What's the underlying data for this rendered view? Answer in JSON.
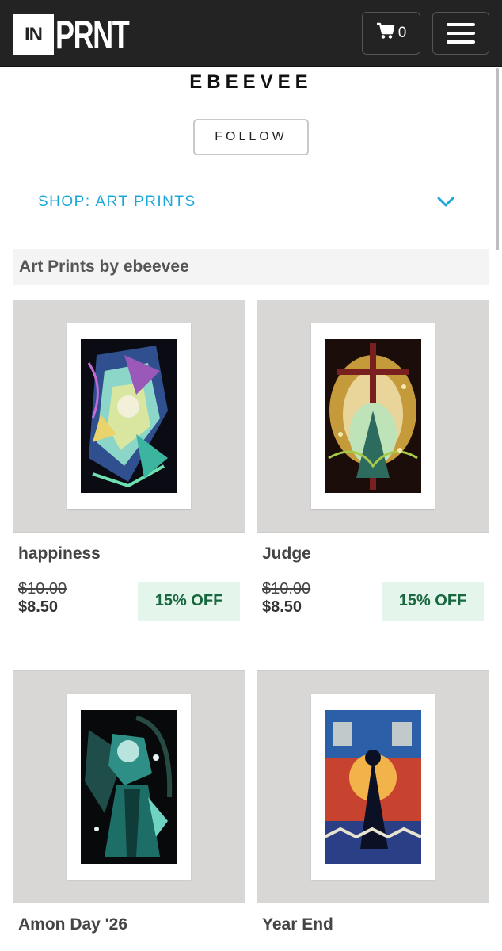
{
  "header": {
    "logo_box": "IN",
    "logo_text": "PRNT",
    "cart_count": "0"
  },
  "shop": {
    "name": "EBEEVEE",
    "follow_label": "FOLLOW",
    "selector_label": "SHOP: ART PRINTS"
  },
  "section": {
    "heading": "Art Prints by ebeevee"
  },
  "products": [
    {
      "title": "happiness",
      "price_old": "$10.00",
      "price_new": "$8.50",
      "badge": "15% OFF"
    },
    {
      "title": "Judge",
      "price_old": "$10.00",
      "price_new": "$8.50",
      "badge": "15% OFF"
    },
    {
      "title": "Amon Day '26"
    },
    {
      "title": "Year End"
    }
  ],
  "colors": {
    "topbar": "#232323",
    "accent": "#1ba8d8",
    "badge_bg": "#e4f5ec",
    "badge_text": "#17683f"
  },
  "icons": {
    "cart": "cart-icon",
    "menu": "hamburger-icon",
    "chevron": "chevron-down-icon"
  }
}
